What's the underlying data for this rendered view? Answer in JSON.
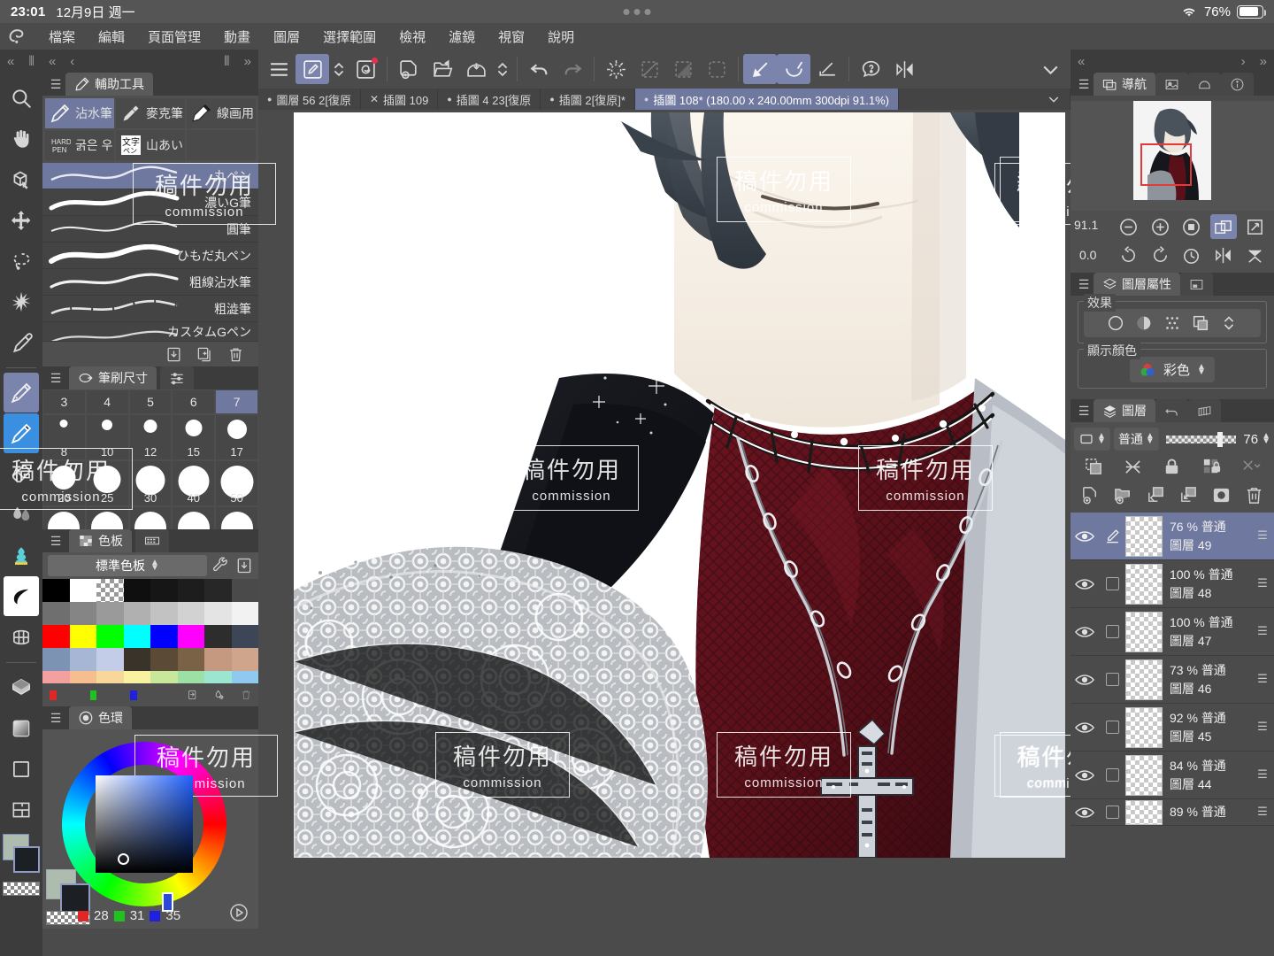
{
  "statusbar": {
    "time": "23:01",
    "date": "12月9日 週一",
    "battery_pct": "76%",
    "wifi_icon": "wifi-icon"
  },
  "menubar": {
    "app_logo": "clip-studio-paint-logo",
    "items": [
      {
        "label": "檔案"
      },
      {
        "label": "編輯"
      },
      {
        "label": "頁面管理"
      },
      {
        "label": "動畫"
      },
      {
        "label": "圖層"
      },
      {
        "label": "選擇範圍"
      },
      {
        "label": "檢視"
      },
      {
        "label": "濾鏡"
      },
      {
        "label": "視窗"
      },
      {
        "label": "說明"
      }
    ]
  },
  "collapse_strip": {
    "left1": "«",
    "grip1": "⦀",
    "left2": "«",
    "left3": "‹",
    "grip2": "⦀",
    "right1": "»"
  },
  "tools": [
    {
      "name": "zoom-tool",
      "icon": "magnifier-icon",
      "selected": false
    },
    {
      "name": "hand-tool",
      "icon": "hand-icon",
      "selected": false
    },
    {
      "name": "rotate-tool",
      "icon": "cube-rotate-icon",
      "selected": false
    },
    {
      "name": "move-tool",
      "icon": "four-arrows-icon",
      "selected": false
    },
    {
      "name": "lasso-select-tool",
      "icon": "lasso-icon",
      "selected": false
    },
    {
      "name": "auto-select-tool",
      "icon": "magic-wand-icon",
      "selected": false
    },
    {
      "name": "eyedropper-tool",
      "icon": "eyedropper-icon",
      "selected": false
    },
    {
      "name": "pen-tool",
      "icon": "pen-nib-icon",
      "selected": true
    },
    {
      "name": "brush-tool",
      "icon": "brush-icon",
      "selected": true
    },
    {
      "name": "eraser-tool",
      "icon": "eraser-icon",
      "selected": false
    },
    {
      "name": "blend-tool",
      "icon": "blend-drops-icon",
      "selected": false
    },
    {
      "name": "decoration-tool",
      "icon": "cream-decoration-icon",
      "selected": false
    },
    {
      "name": "ink-tool",
      "icon": "ink-leaf-icon",
      "selected": false
    },
    {
      "name": "mesh-transform-tool",
      "icon": "mesh-grid-icon",
      "selected": false
    },
    {
      "name": "fill-tool",
      "icon": "fill-bucket-icon",
      "selected": false
    },
    {
      "name": "gradient-tool",
      "icon": "gradient-square-icon",
      "selected": false
    },
    {
      "name": "figure-tool",
      "icon": "square-shape-icon",
      "selected": false
    },
    {
      "name": "frame-border-tool",
      "icon": "frame-divide-icon",
      "selected": false
    }
  ],
  "color_swatch": {
    "foreground": "#aebcb0",
    "background": "#1c1f23",
    "transparent_label": "transparent-swatch"
  },
  "subtool_panel": {
    "title": "輔助工具",
    "tab_icon": "subtool-icon",
    "chips": [
      {
        "label": "沾水筆",
        "icon": "pen-icon",
        "active": true
      },
      {
        "label": "麥克筆",
        "icon": "marker-icon",
        "active": false
      },
      {
        "label": "線画用",
        "icon": "lineart-pen-icon",
        "active": false
      },
      {
        "label": "굵은 우",
        "icon": "hard-pen-icon",
        "active": false
      },
      {
        "label": "山あい",
        "icon": "text-brush-icon",
        "active": false
      },
      {
        "label": "",
        "icon": "empty-slot",
        "active": false
      }
    ],
    "brushes": [
      {
        "label": "丸ペン",
        "selected": true
      },
      {
        "label": "濃いG筆",
        "selected": false
      },
      {
        "label": "圓筆",
        "selected": false
      },
      {
        "label": "ひもだ丸ペン",
        "selected": false
      },
      {
        "label": "粗線沾水筆",
        "selected": false
      },
      {
        "label": "粗澁筆",
        "selected": false
      },
      {
        "label": "カスタムGペン",
        "selected": false
      }
    ],
    "footer_icons": [
      "import-icon",
      "duplicate-icon",
      "trash-icon"
    ]
  },
  "brush_size_panel": {
    "title": "筆刷尺寸",
    "tab_icon": "brush-size-icon",
    "settings_icon": "sliders-icon",
    "row_small": [
      "3",
      "4",
      "5",
      "6",
      "7"
    ],
    "selected_small": "7",
    "row_mid": [
      "8",
      "10",
      "12",
      "15",
      "17"
    ],
    "row_large": [
      "20",
      "25",
      "30",
      "40",
      "50"
    ]
  },
  "color_set_panel": {
    "title": "色板",
    "tab_icon": "colorset-icon",
    "second_tab_icon": "filmstrip-icon",
    "dropdown_value": "標準色板",
    "wrench_icon": "wrench-icon",
    "import_icon": "import-icon",
    "swatch_rows": [
      [
        "#000000",
        "#ffffff",
        "__checker__",
        "#0f0f0f",
        "#161616",
        "#1d1d1d",
        "#272727",
        "#4a4a4a"
      ],
      [
        "#6f6f6f",
        "#858585",
        "#9a9a9a",
        "#b0b0b0",
        "#c2c2c2",
        "#d2d2d2",
        "#e4e4e4",
        "#f2f2f2"
      ],
      [
        "#ff0000",
        "#ffff00",
        "#00ff00",
        "#00ffff",
        "#0000ff",
        "#ff00ff",
        "#2d2d2d",
        "#3c4657"
      ],
      [
        "#7d93b4",
        "#a8b6d6",
        "#c3cde8",
        "#3a332a",
        "#5a4a36",
        "#7a6247",
        "#c59880",
        "#cfa58c"
      ],
      [
        "#f4a0a0",
        "#f6be8e",
        "#f7d79a",
        "#f9f2a0",
        "#c8e79a",
        "#9ce0a6",
        "#9ce5d0",
        "#8fc9f0"
      ]
    ],
    "footer_minis": [
      "#e02626",
      "#1fc21f",
      "#2020e0"
    ],
    "footer_icons": [
      "add-color-icon",
      "drop-plus-icon",
      "trash-icon"
    ]
  },
  "color_wheel_panel": {
    "title": "色環",
    "tab_icon": "circle-icon",
    "rgb": {
      "r_label": "28",
      "g_label": "31",
      "b_label": "35",
      "r_color": "#e02626",
      "g_color": "#1fc21f",
      "b_color": "#2020e0"
    },
    "play_icon": "play-circle-icon"
  },
  "command_bar": {
    "buttons": [
      {
        "name": "menu-button",
        "icon": "hamburger-icon",
        "active": false,
        "disabled": false
      },
      {
        "name": "subtool-quick-button",
        "icon": "pen-square-icon",
        "active": true,
        "disabled": false
      },
      {
        "name": "subtool-stepper",
        "icon": "chevron-updown-icon",
        "active": false,
        "disabled": false
      },
      {
        "name": "autoaction-button",
        "icon": "swirl-square-icon",
        "active": false,
        "disabled": false,
        "badge": true
      },
      {
        "name": "new-file-button",
        "icon": "new-page-icon",
        "active": false,
        "disabled": false
      },
      {
        "name": "open-file-button",
        "icon": "open-folder-icon",
        "active": false,
        "disabled": false
      },
      {
        "name": "save-button",
        "icon": "save-icon",
        "active": false,
        "disabled": false
      },
      {
        "name": "save-stepper",
        "icon": "chevron-updown-icon",
        "active": false,
        "disabled": false
      },
      {
        "name": "undo-button",
        "icon": "undo-arrow-icon",
        "active": false,
        "disabled": false
      },
      {
        "name": "redo-button",
        "icon": "redo-arrow-icon",
        "active": false,
        "disabled": true
      },
      {
        "name": "clear-button",
        "icon": "burst-icon",
        "active": false,
        "disabled": false
      },
      {
        "name": "fill-selection-button",
        "icon": "fill-dashed-icon",
        "active": false,
        "disabled": true
      },
      {
        "name": "bucket-fill-button",
        "icon": "bucket-icon",
        "active": false,
        "disabled": false
      },
      {
        "name": "transform-button",
        "icon": "transform-icon",
        "active": false,
        "disabled": false
      },
      {
        "name": "deselect-button",
        "icon": "deselect-icon",
        "active": false,
        "disabled": true
      },
      {
        "name": "invert-selection-button",
        "icon": "invert-select-icon",
        "active": false,
        "disabled": true
      },
      {
        "name": "select-border-button",
        "icon": "select-border-icon",
        "active": false,
        "disabled": true
      },
      {
        "name": "straight-line-button",
        "icon": "line-arrow-icon",
        "active": true,
        "disabled": false
      },
      {
        "name": "curve-button",
        "icon": "curve-brush-icon",
        "active": true,
        "disabled": false
      },
      {
        "name": "perspective-ruler-button",
        "icon": "ruler-icon",
        "active": false,
        "disabled": false
      },
      {
        "name": "help-button",
        "icon": "question-bubble-icon",
        "active": false,
        "disabled": false
      },
      {
        "name": "flip-horizontal-button",
        "icon": "flip-horizontal-icon",
        "active": false,
        "disabled": false
      },
      {
        "name": "expand-commandbar-button",
        "icon": "chevron-down-icon",
        "active": false,
        "disabled": false
      }
    ]
  },
  "document_tabs": [
    {
      "label": "圖層 56 2[復原",
      "active": false,
      "modified": true,
      "closable": false
    },
    {
      "label": "插圖 109",
      "active": false,
      "modified": false,
      "closable": true
    },
    {
      "label": "插圖 4 23[復原",
      "active": false,
      "modified": true,
      "closable": false
    },
    {
      "label": "插圖 2[復原]*",
      "active": false,
      "modified": true,
      "closable": false
    },
    {
      "label": "插圖 108* (180.00 x 240.00mm 300dpi 91.1%)",
      "active": true,
      "modified": true,
      "closable": false
    }
  ],
  "doctabs_overflow_icon": "chevron-down-icon",
  "watermark": {
    "line1": "稿件勿用",
    "line2": "commission"
  },
  "navigator_panel": {
    "title": "導航",
    "tab_icon": "navigator-icon",
    "other_tabs": [
      "subview-icon",
      "item-bank-icon",
      "info-icon"
    ],
    "zoom_value": "91.1",
    "rotation_value": "0.0",
    "buttons": [
      {
        "name": "zoom-out-button",
        "icon": "minus-circle-icon",
        "active": false
      },
      {
        "name": "zoom-in-button",
        "icon": "plus-circle-icon",
        "active": false
      },
      {
        "name": "fit-button",
        "icon": "stop-circle-icon",
        "active": false
      },
      {
        "name": "fit-to-screen-button",
        "icon": "fit-screen-icon",
        "active": true
      },
      {
        "name": "full-screen-button",
        "icon": "expand-diagonal-icon",
        "active": false
      },
      {
        "name": "rotate-left-button",
        "icon": "rotate-ccw-icon",
        "active": false
      },
      {
        "name": "rotate-right-button",
        "icon": "rotate-cw-icon",
        "active": false
      },
      {
        "name": "reset-rotation-button",
        "icon": "rotate-reset-icon",
        "active": false
      },
      {
        "name": "flip-canvas-button",
        "icon": "flip-horizontal-icon",
        "active": false
      },
      {
        "name": "collapse-navigator-button",
        "icon": "collapse-arrows-icon",
        "active": false
      }
    ]
  },
  "layer_property_panel": {
    "title": "圖層屬性",
    "tab_icon": "layer-property-icon",
    "second_tab_icon": "layer-mask-icon",
    "effect_label": "效果",
    "effect_buttons": [
      "none-circle-icon",
      "border-effect-icon",
      "tone-dots-icon",
      "layer-color-icon",
      "chevron-updown-icon"
    ],
    "display_color_label": "顯示顏色",
    "display_color_value": "彩色",
    "display_color_icon": "rgb-circles-icon"
  },
  "layer_panel": {
    "title": "圖層",
    "tab_icon": "layers-icon",
    "other_tabs": [
      "history-icon",
      "animation-icon"
    ],
    "mask_icon": "layer-mask-square-icon",
    "blend_mode": "普通",
    "opacity_value": "76",
    "row2_icons": [
      "clip-to-layer-icon",
      "mask-off-icon",
      "lock-layer-icon",
      "lock-transparent-icon",
      "ruler-range-icon"
    ],
    "row3_icons": [
      "new-raster-layer-icon",
      "new-folder-icon",
      "transfer-down-icon",
      "merge-down-icon",
      "layer-mask-icon",
      "delete-layer-icon"
    ],
    "layers": [
      {
        "opacity": "76 %",
        "blend": "普通",
        "name": "圖層 49",
        "selected": true,
        "visible": true,
        "locked": false,
        "has_pen": true
      },
      {
        "opacity": "100 %",
        "blend": "普通",
        "name": "圖層 48",
        "selected": false,
        "visible": true,
        "locked": false,
        "has_pen": false
      },
      {
        "opacity": "100 %",
        "blend": "普通",
        "name": "圖層 47",
        "selected": false,
        "visible": true,
        "locked": false,
        "has_pen": false
      },
      {
        "opacity": "73 %",
        "blend": "普通",
        "name": "圖層 46",
        "selected": false,
        "visible": true,
        "locked": false,
        "has_pen": false
      },
      {
        "opacity": "92 %",
        "blend": "普通",
        "name": "圖層 45",
        "selected": false,
        "visible": true,
        "locked": false,
        "has_pen": false
      },
      {
        "opacity": "84 %",
        "blend": "普通",
        "name": "圖層 44",
        "selected": false,
        "visible": true,
        "locked": false,
        "has_pen": false
      },
      {
        "opacity": "89 %",
        "blend": "普通",
        "name": "",
        "selected": false,
        "visible": true,
        "locked": false,
        "has_pen": false
      }
    ]
  },
  "colors": {
    "accent": "#6f789e",
    "panel_bg": "#4b4b4b",
    "dark_bg": "#3c3c3c",
    "highlight_blue": "#3a8fe0"
  }
}
